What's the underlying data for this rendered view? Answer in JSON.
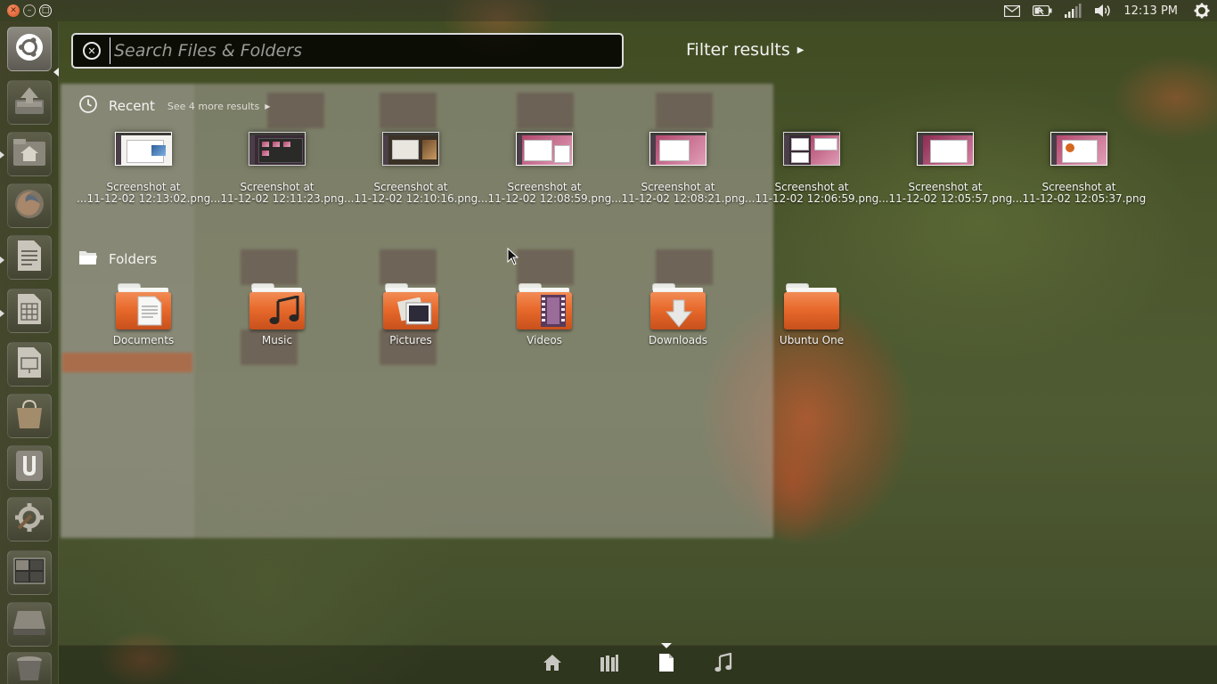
{
  "panel": {
    "clock": "12:13 PM",
    "indicators": [
      "mail-icon",
      "battery-icon",
      "network-signal-icon",
      "volume-icon",
      "session-gear-icon"
    ]
  },
  "window_controls": [
    "close-icon",
    "minimize-icon",
    "maximize-icon"
  ],
  "launcher": {
    "items": [
      {
        "name": "dash-home-button",
        "icon": "ubuntu-logo-icon"
      },
      {
        "name": "launcher-item-update-manager",
        "icon": "system-update-icon"
      },
      {
        "name": "launcher-item-home-folder",
        "icon": "home-folder-icon"
      },
      {
        "name": "launcher-item-firefox",
        "icon": "firefox-icon"
      },
      {
        "name": "launcher-item-writer",
        "icon": "libreoffice-writer-icon"
      },
      {
        "name": "launcher-item-calc",
        "icon": "libreoffice-calc-icon"
      },
      {
        "name": "launcher-item-impress",
        "icon": "libreoffice-impress-icon"
      },
      {
        "name": "launcher-item-software-center",
        "icon": "software-center-icon"
      },
      {
        "name": "launcher-item-ubuntu-one",
        "icon": "ubuntu-one-icon"
      },
      {
        "name": "launcher-item-system-settings",
        "icon": "system-settings-icon"
      },
      {
        "name": "launcher-item-workspace-switcher",
        "icon": "workspace-switcher-icon"
      },
      {
        "name": "launcher-item-drive",
        "icon": "drive-icon"
      },
      {
        "name": "launcher-item-trash",
        "icon": "trash-icon"
      }
    ]
  },
  "dash": {
    "search": {
      "placeholder": "Search Files & Folders",
      "value": ""
    },
    "filter_results": "Filter results",
    "recent": {
      "title": "Recent",
      "more": "See 4 more results",
      "items": [
        {
          "line1": "Screenshot at",
          "line2": "...11-12-02 12:13:02.png"
        },
        {
          "line1": "Screenshot at",
          "line2": "...11-12-02 12:11:23.png"
        },
        {
          "line1": "Screenshot at",
          "line2": "...11-12-02 12:10:16.png"
        },
        {
          "line1": "Screenshot at",
          "line2": "...11-12-02 12:08:59.png"
        },
        {
          "line1": "Screenshot at",
          "line2": "...11-12-02 12:08:21.png"
        },
        {
          "line1": "Screenshot at",
          "line2": "...11-12-02 12:06:59.png"
        },
        {
          "line1": "Screenshot at",
          "line2": "...11-12-02 12:05:57.png"
        },
        {
          "line1": "Screenshot at",
          "line2": "...11-12-02 12:05:37.png"
        }
      ]
    },
    "folders": {
      "title": "Folders",
      "items": [
        {
          "label": "Documents",
          "icon": "documents-folder-icon"
        },
        {
          "label": "Music",
          "icon": "music-folder-icon"
        },
        {
          "label": "Pictures",
          "icon": "pictures-folder-icon"
        },
        {
          "label": "Videos",
          "icon": "videos-folder-icon"
        },
        {
          "label": "Downloads",
          "icon": "downloads-folder-icon"
        },
        {
          "label": "Ubuntu One",
          "icon": "ubuntu-one-folder-icon"
        }
      ]
    },
    "lenses": [
      {
        "name": "lens-home",
        "icon": "home-lens-icon",
        "active": false
      },
      {
        "name": "lens-applications",
        "icon": "applications-lens-icon",
        "active": false
      },
      {
        "name": "lens-files",
        "icon": "files-lens-icon",
        "active": true
      },
      {
        "name": "lens-music",
        "icon": "music-lens-icon",
        "active": false
      }
    ]
  }
}
